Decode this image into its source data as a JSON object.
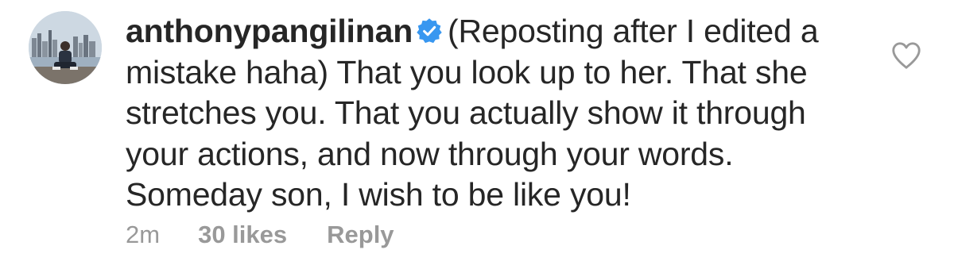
{
  "comment": {
    "username": "anthonypangilinan",
    "verified": true,
    "text": "(Reposting after I edited a mistake haha) That you look up to her. That she stretches you. That you actually show it through your actions, and now through your words. Someday son, I wish to be like you!",
    "time": "2m",
    "likes": "30 likes",
    "reply_label": "Reply"
  },
  "icons": {
    "verified": "verified-badge-icon",
    "like": "heart-outline-icon"
  },
  "colors": {
    "text": "#262626",
    "meta": "#999999",
    "verified": "#3897f0"
  }
}
